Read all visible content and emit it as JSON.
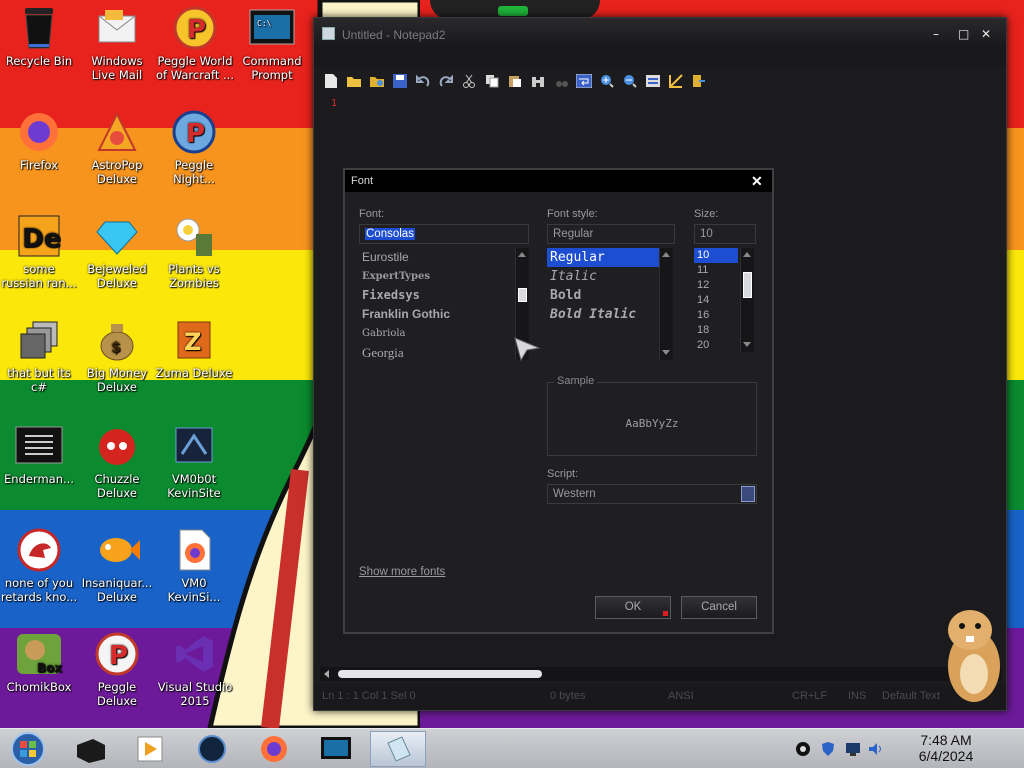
{
  "desktop": {
    "icons": [
      {
        "label": "Recycle Bin",
        "icon": "recycle-bin-icon"
      },
      {
        "label": "Windows\nLive Mail",
        "icon": "mail-icon"
      },
      {
        "label": "Peggle World\nof Warcraft ...",
        "icon": "peggle-icon"
      },
      {
        "label": "Command\nPrompt",
        "icon": "command-prompt-icon"
      },
      {
        "label": "Firefox",
        "icon": "firefox-icon"
      },
      {
        "label": "AstroPop\nDeluxe",
        "icon": "astropop-icon"
      },
      {
        "label": "Peggle\nNight...",
        "icon": "peggle-night-icon"
      },
      {
        "label": "some\nrussian ran...",
        "icon": "de-icon"
      },
      {
        "label": "Bejeweled\nDeluxe",
        "icon": "gem-icon"
      },
      {
        "label": "Plants vs\nZombies",
        "icon": "plants-icon"
      },
      {
        "label": "that but its c#",
        "icon": "windows-stack-icon"
      },
      {
        "label": "Big Money\nDeluxe",
        "icon": "money-bag-icon"
      },
      {
        "label": "Zuma Deluxe",
        "icon": "zuma-icon"
      },
      {
        "label": "Enderman...",
        "icon": "console-icon"
      },
      {
        "label": "Chuzzle\nDeluxe",
        "icon": "chuzzle-icon"
      },
      {
        "label": "VM0b0t\nKevinSite",
        "icon": "vmobot-icon"
      },
      {
        "label": "none of you\nretards kno...",
        "icon": "dino-icon"
      },
      {
        "label": "Insaniquar...\nDeluxe",
        "icon": "fish-icon"
      },
      {
        "label": "VM0\nKevinSi...",
        "icon": "firefox-file-icon"
      },
      {
        "label": "ChomikBox",
        "icon": "chomikbox-icon"
      },
      {
        "label": "Peggle\nDeluxe",
        "icon": "peggle-deluxe-icon"
      },
      {
        "label": "Visual Studio\n2015",
        "icon": "visual-studio-icon"
      }
    ]
  },
  "notepad": {
    "title": "Untitled - Notepad2",
    "controls": {
      "minimize": "–",
      "maximize": "□",
      "close": "✕"
    },
    "line_number": "1",
    "status": {
      "position": "Ln 1 : 1   Col 1   Sel 0",
      "size": "0 bytes",
      "encoding": "ANSI",
      "line_endings": "CR+LF",
      "mode": "INS",
      "scheme": "Default Text"
    }
  },
  "font_dialog": {
    "title": "Font",
    "close": "✕",
    "font_label": "Font:",
    "font_value": "Consolas",
    "fonts": [
      "Eurostile",
      "ExpertTypes",
      "Fixedsys",
      "Franklin Gothic",
      "Gabriola",
      "Georgia"
    ],
    "style_label": "Font style:",
    "style_value": "Regular",
    "styles": [
      "Regular",
      "Italic",
      "Bold",
      "Bold Italic"
    ],
    "selected_style": "Regular",
    "size_label": "Size:",
    "size_value": "10",
    "sizes": [
      "10",
      "11",
      "12",
      "14",
      "16",
      "18",
      "20"
    ],
    "selected_size": "10",
    "sample_label": "Sample",
    "sample_text": "AaBbYyZz",
    "script_label": "Script:",
    "script_value": "Western",
    "show_more": "Show more fonts",
    "ok": "OK",
    "cancel": "Cancel"
  },
  "taskbar": {
    "time": "7:48 AM",
    "date": "6/4/2024"
  },
  "colors": {
    "stripe_red": "#e8221c",
    "stripe_orange": "#f7941d",
    "stripe_yellow": "#fbe80a",
    "stripe_green": "#0b8a2f",
    "stripe_blue": "#1862c8",
    "stripe_purple": "#6d1a9a",
    "selection": "#1d4dd0"
  }
}
